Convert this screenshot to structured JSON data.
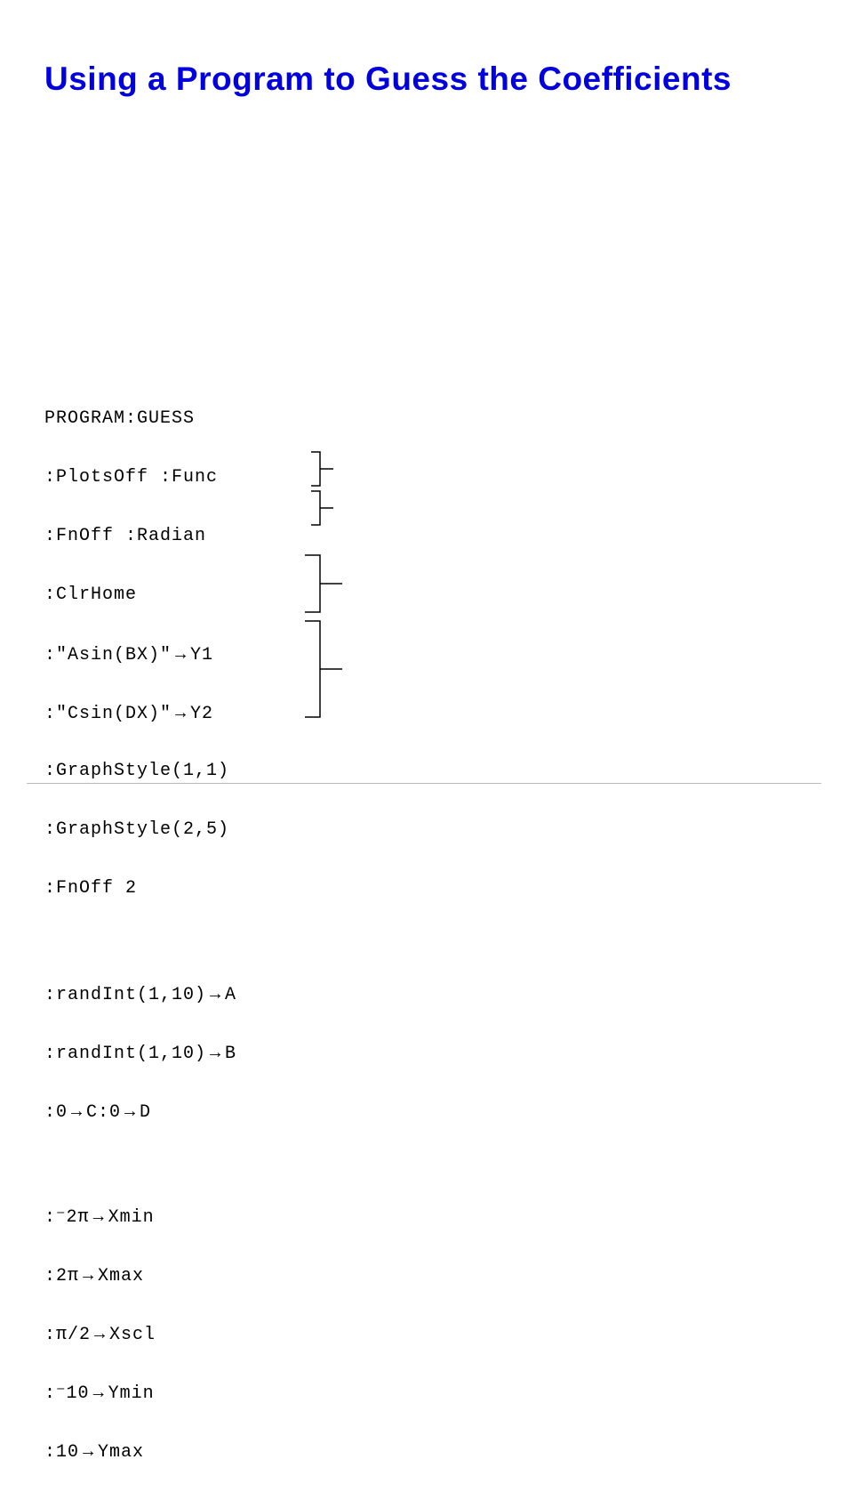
{
  "title": "Using a Program to Guess the Coefficients",
  "code": {
    "l0": "PROGRAM:GUESS",
    "l1": ":PlotsOff :Func",
    "l2": ":FnOff :Radian",
    "l3": ":ClrHome",
    "l4a": ":\"Asin(BX)\"",
    "l4b": "Y1",
    "l5a": ":\"Csin(DX)\"",
    "l5b": "Y2",
    "l6": ":GraphStyle(1,1)",
    "l7": ":GraphStyle(2,5)",
    "l8": ":FnOff 2",
    "l9a": ":randInt(1,10)",
    "l9b": "A",
    "l10a": ":randInt(1,10)",
    "l10b": "B",
    "l11a": ":0",
    "l11b": "C:0",
    "l11c": "D",
    "l12a": ":⁻2π",
    "l12b": "Xmin",
    "l13a": ":2π",
    "l13b": "Xmax",
    "l14a": ":π/2",
    "l14b": "Xscl",
    "l15a": ":⁻10",
    "l15b": "Ymin",
    "l16a": ":10",
    "l16b": "Ymax"
  },
  "arrow_glyph": "→"
}
